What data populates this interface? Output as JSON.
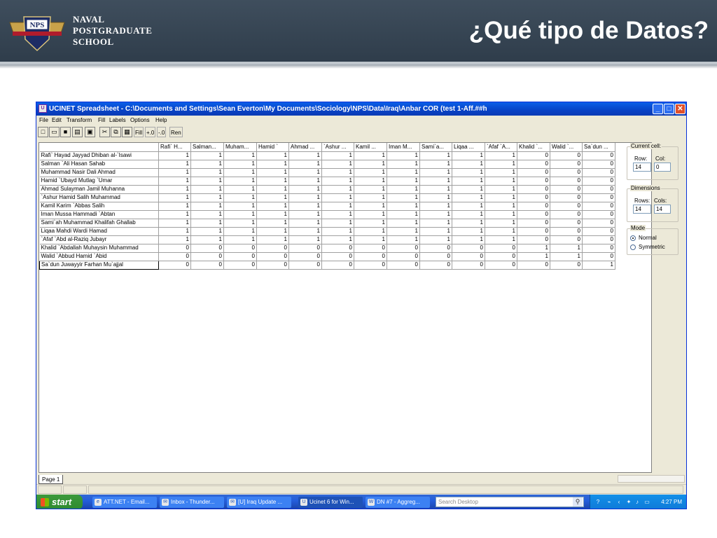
{
  "slide": {
    "school_name": [
      "NAVAL",
      "POSTGRADUATE",
      "SCHOOL"
    ],
    "logo_text": "NPS",
    "title": "¿Qué tipo de Datos?"
  },
  "window": {
    "title": "UCINET Spreadsheet - C:\\Documents and Settings\\Sean Everton\\My Documents\\Sociology\\NPS\\Data\\Iraq\\Anbar COR (test 1-Aff.##h",
    "menu": [
      "File",
      "Edit",
      "Transform",
      "Fill",
      "Labels",
      "Options",
      "Help"
    ],
    "toolbar_text": [
      "Fill",
      "+.0",
      "-.0",
      "Ren"
    ],
    "toolbar_icons": [
      "new-icon",
      "open-icon",
      "save-icon",
      "print-icon",
      "preview-icon",
      "cut-icon",
      "copy-icon",
      "paste-icon"
    ]
  },
  "grid": {
    "columns": [
      "Rafi` H...",
      "Salman...",
      "Muham...",
      "Hamid `",
      "Ahmad ...",
      "`Ashur ...",
      "Kamil ...",
      "Iman M...",
      "Sami`a...",
      "Liqaa ...",
      "`Afaf `A...",
      "Khalid `...",
      "Walid `...",
      "Sa`dun ..."
    ],
    "rows": [
      {
        "label": "Rafi` Hayad Jayyad Dhiban al-`Isawi",
        "values": [
          "1",
          "1",
          "1",
          "1",
          "1",
          "1",
          "1",
          "1",
          "1",
          "1",
          "1",
          "0",
          "0",
          "0"
        ]
      },
      {
        "label": "Salman `Ali Hasan Sahab",
        "values": [
          "1",
          "1",
          "1",
          "1",
          "1",
          "1",
          "1",
          "1",
          "1",
          "1",
          "1",
          "0",
          "0",
          "0"
        ]
      },
      {
        "label": "Muhammad Nasir Dali Ahmad",
        "values": [
          "1",
          "1",
          "1",
          "1",
          "1",
          "1",
          "1",
          "1",
          "1",
          "1",
          "1",
          "0",
          "0",
          "0"
        ]
      },
      {
        "label": "Hamid `Ubayd Mutlag `Umar",
        "values": [
          "1",
          "1",
          "1",
          "1",
          "1",
          "1",
          "1",
          "1",
          "1",
          "1",
          "1",
          "0",
          "0",
          "0"
        ]
      },
      {
        "label": "Ahmad Sulayman Jamil Muhanna",
        "values": [
          "1",
          "1",
          "1",
          "1",
          "1",
          "1",
          "1",
          "1",
          "1",
          "1",
          "1",
          "0",
          "0",
          "0"
        ]
      },
      {
        "label": "`Ashur Hamid Salih Muhammad",
        "values": [
          "1",
          "1",
          "1",
          "1",
          "1",
          "1",
          "1",
          "1",
          "1",
          "1",
          "1",
          "0",
          "0",
          "0"
        ]
      },
      {
        "label": "Kamil Karim `Abbas Salih",
        "values": [
          "1",
          "1",
          "1",
          "1",
          "1",
          "1",
          "1",
          "1",
          "1",
          "1",
          "1",
          "0",
          "0",
          "0"
        ]
      },
      {
        "label": "Iman Mussa Hammadi `Abtan",
        "values": [
          "1",
          "1",
          "1",
          "1",
          "1",
          "1",
          "1",
          "1",
          "1",
          "1",
          "1",
          "0",
          "0",
          "0"
        ]
      },
      {
        "label": "Sami`ah Muhammad Khalifah Ghallab",
        "values": [
          "1",
          "1",
          "1",
          "1",
          "1",
          "1",
          "1",
          "1",
          "1",
          "1",
          "1",
          "0",
          "0",
          "0"
        ]
      },
      {
        "label": "Liqaa Mahdi Wardi Hamad",
        "values": [
          "1",
          "1",
          "1",
          "1",
          "1",
          "1",
          "1",
          "1",
          "1",
          "1",
          "1",
          "0",
          "0",
          "0"
        ]
      },
      {
        "label": "`Afaf `Abd al-Raziq Jubayr",
        "values": [
          "1",
          "1",
          "1",
          "1",
          "1",
          "1",
          "1",
          "1",
          "1",
          "1",
          "1",
          "0",
          "0",
          "0"
        ]
      },
      {
        "label": "Khalid `Abdallah Muhaysin Muhammad",
        "values": [
          "0",
          "0",
          "0",
          "0",
          "0",
          "0",
          "0",
          "0",
          "0",
          "0",
          "0",
          "1",
          "1",
          "0"
        ]
      },
      {
        "label": "Walid `Abbud Hamid `Abid",
        "values": [
          "0",
          "0",
          "0",
          "0",
          "0",
          "0",
          "0",
          "0",
          "0",
          "0",
          "0",
          "1",
          "1",
          "0"
        ]
      },
      {
        "label": "Sa`dun Juwayyir Farhan Mu`ajjal",
        "values": [
          "0",
          "0",
          "0",
          "0",
          "0",
          "0",
          "0",
          "0",
          "0",
          "0",
          "0",
          "0",
          "0",
          "1"
        ]
      }
    ]
  },
  "panel": {
    "current_cell": {
      "legend": "Current cell:",
      "row_label": "Row:",
      "col_label": "Col:",
      "row": "14",
      "col": "0"
    },
    "dimensions": {
      "legend": "Dimensions",
      "rows_label": "Rows:",
      "cols_label": "Cols:",
      "rows": "14",
      "cols": "14"
    },
    "mode": {
      "legend": "Mode",
      "options": [
        "Normal",
        "Symmetric"
      ],
      "selected": "Normal"
    }
  },
  "sheet_tab": "Page 1",
  "taskbar": {
    "start": "start",
    "buttons": [
      "ATT.NET - Email...",
      "Inbox - Thunder...",
      "[U] Iraq Update ...",
      "Ucinet 6 for Win...",
      "DN #7 - Aggreg..."
    ],
    "active_button": "Ucinet 6 for Win...",
    "search_placeholder": "Search Desktop",
    "clock": "4:27 PM"
  }
}
